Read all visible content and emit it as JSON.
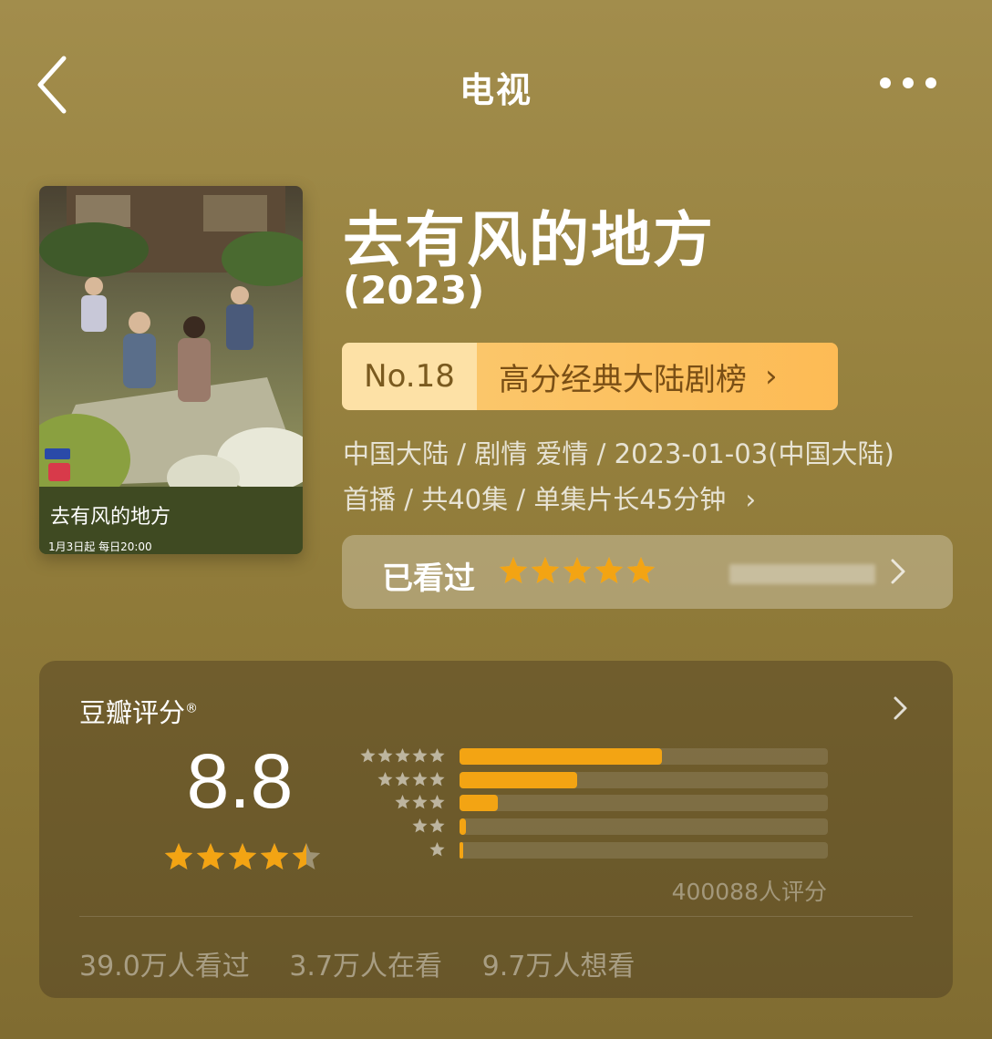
{
  "header": {
    "title": "电视",
    "back_icon": "chevron-left-icon",
    "more_icon": "ellipsis-icon"
  },
  "poster": {
    "title_text": "去有风的地方",
    "airtime_text": "1月3日起 每日20:00"
  },
  "show": {
    "title": "去有风的地方",
    "year": "(2023)",
    "rank_no": "No.18",
    "rank_list": "高分经典大陆剧榜",
    "meta_line1": "中国大陆 / 剧情 爱情 / 2023-01-03(中国大陆)",
    "meta_line2": "首播 / 共40集 / 单集片长45分钟"
  },
  "user": {
    "watched_label": "已看过",
    "my_rating_stars": 5
  },
  "rating": {
    "title": "豆瓣评分",
    "mark": "®",
    "score": "8.8",
    "stars": 4.5,
    "distribution": [
      0.55,
      0.32,
      0.105,
      0.018,
      0.007
    ],
    "rater_count": "400088人评分",
    "stats": {
      "watched": "39.0万人看过",
      "watching": "3.7万人在看",
      "wish": "9.7万人想看"
    }
  },
  "colors": {
    "accent": "#f3a413",
    "rank_no_bg": "#fde1a6",
    "rank_list_bg": "#fbc66a"
  }
}
